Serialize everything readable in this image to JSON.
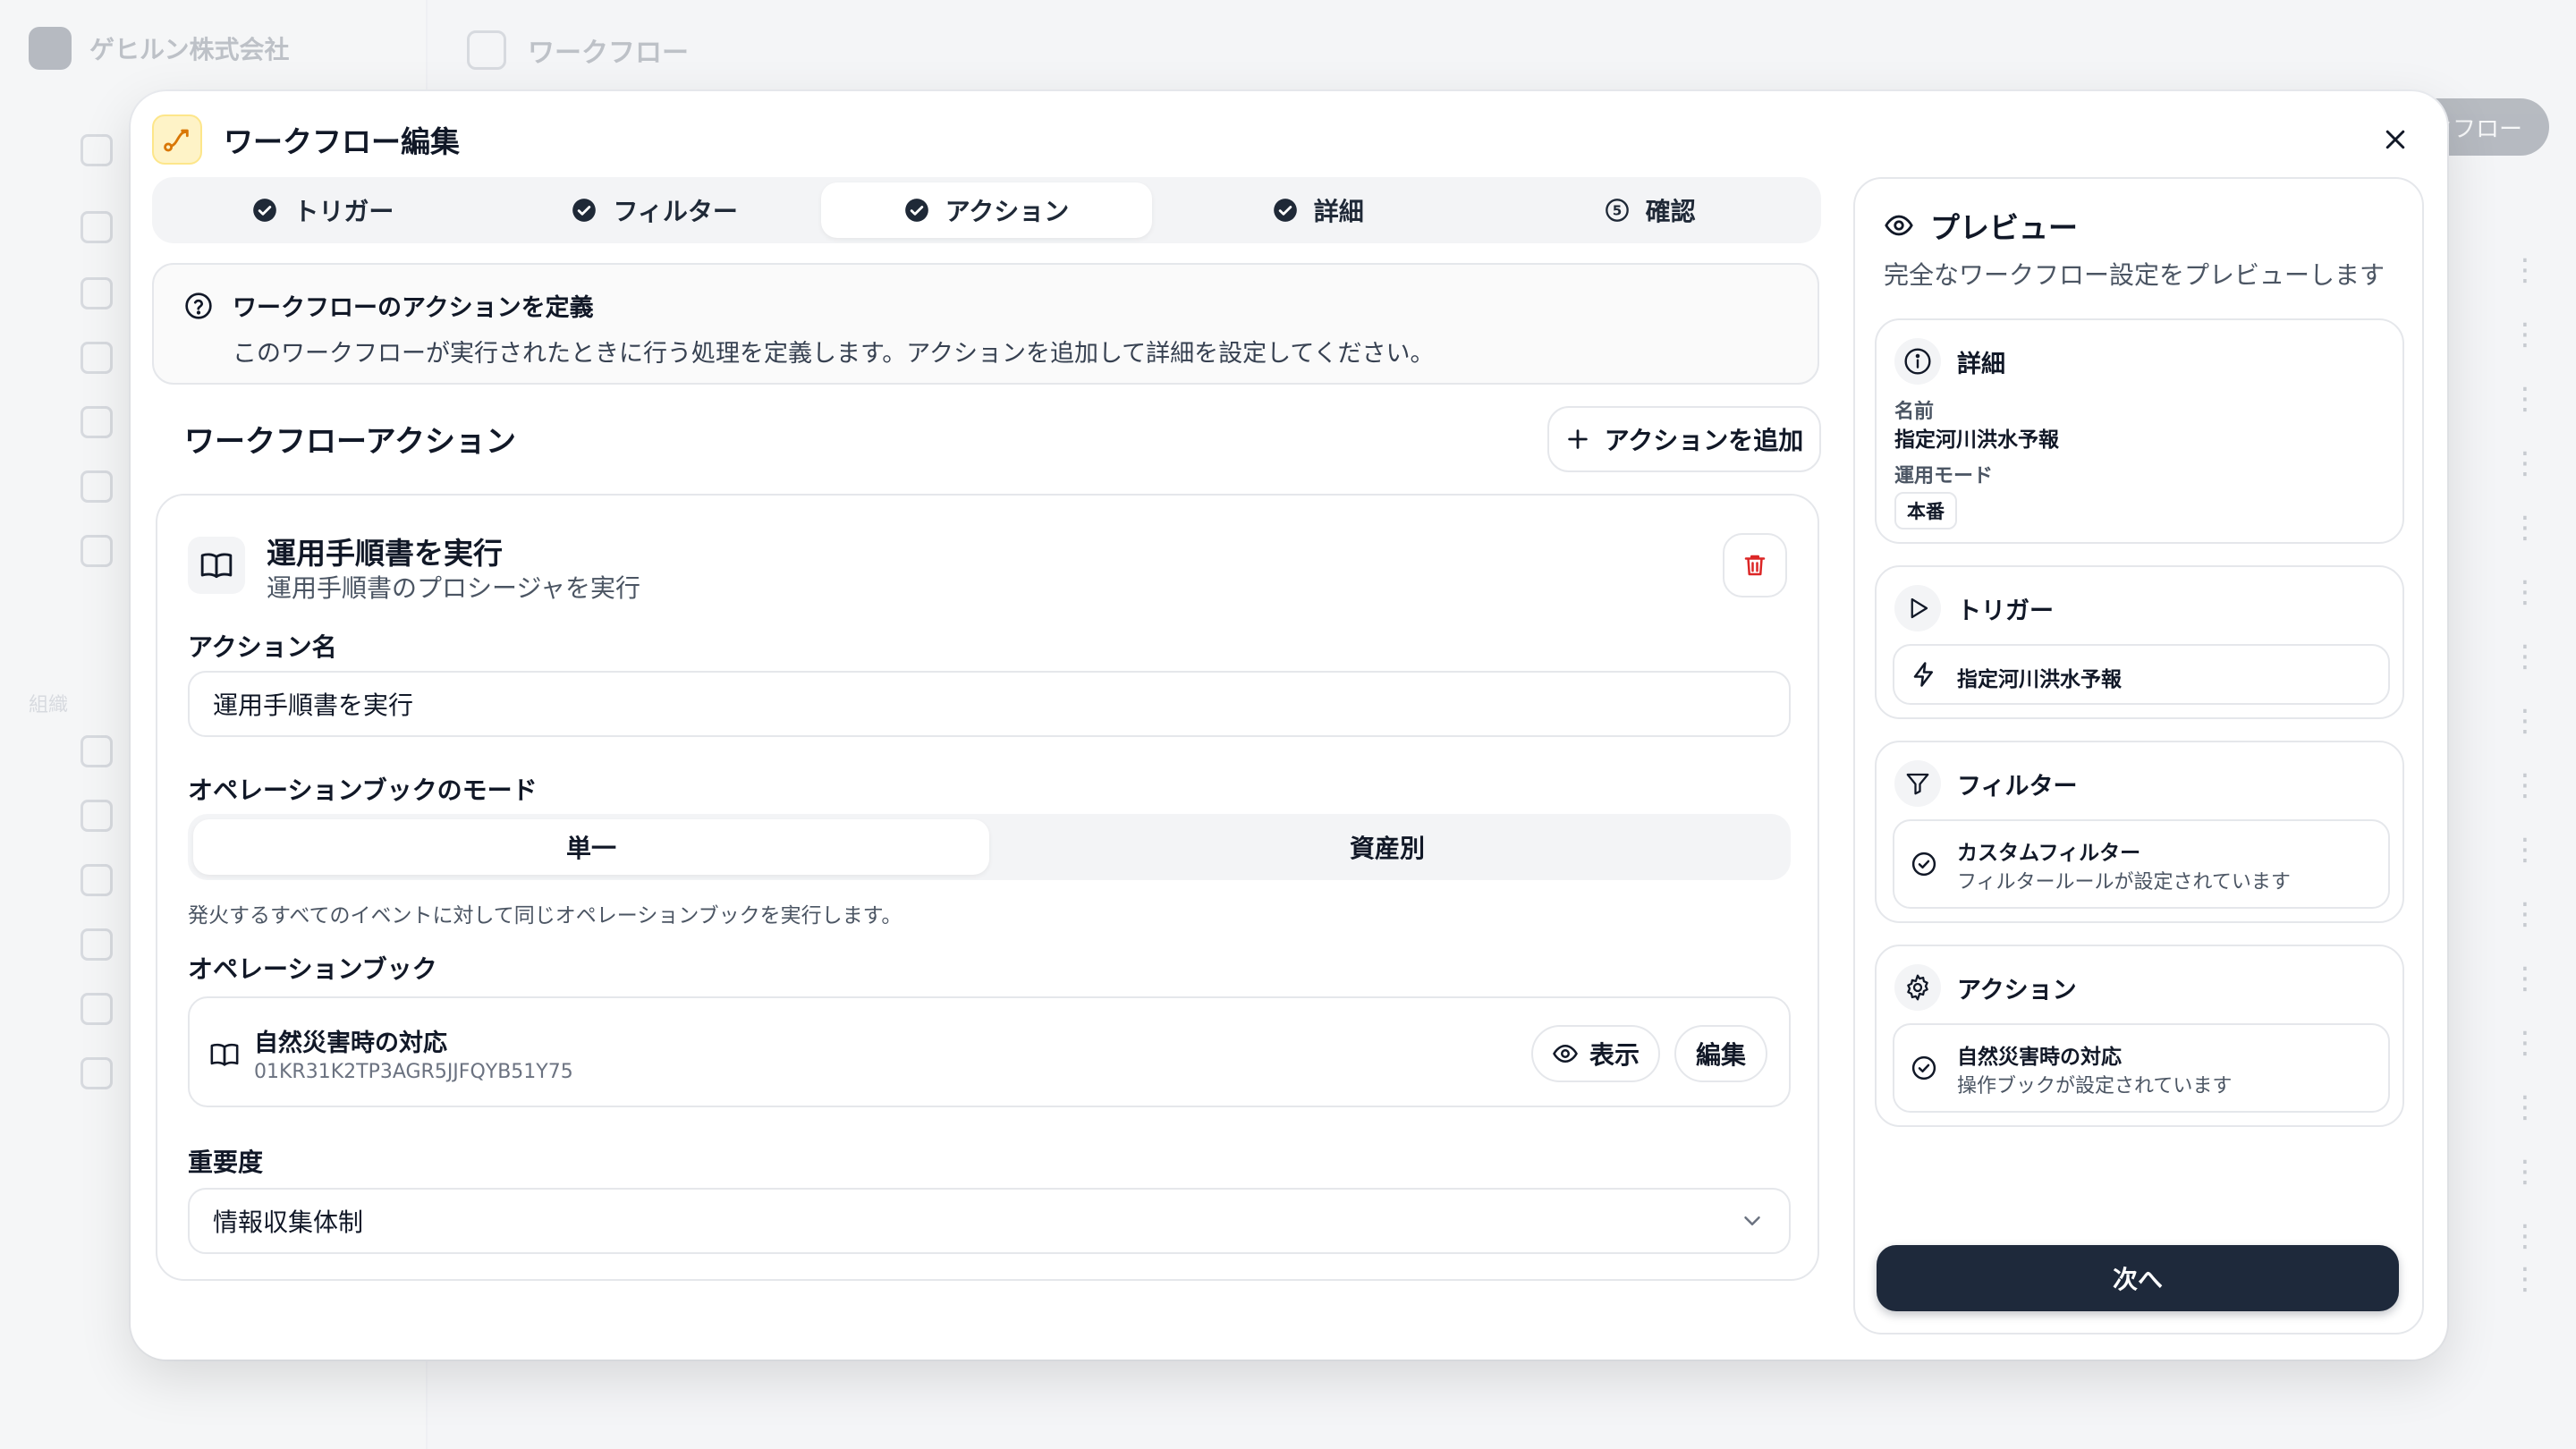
{
  "background": {
    "org_name": "ゲヒルン株式会社",
    "header_title": "ワークフロー",
    "section_label": "組織",
    "header_button": "ワークフロー"
  },
  "modal": {
    "title": "ワークフロー編集",
    "steps": [
      {
        "label": "トリガー",
        "state": "done"
      },
      {
        "label": "フィルター",
        "state": "done"
      },
      {
        "label": "アクション",
        "state": "active"
      },
      {
        "label": "詳細",
        "state": "done"
      },
      {
        "label": "確認",
        "state": "pending",
        "number": "5"
      }
    ],
    "info": {
      "title": "ワークフローのアクションを定義",
      "description": "このワークフローが実行されたときに行う処理を定義します。アクションを追加して詳細を設定してください。"
    },
    "actions_section": {
      "title": "ワークフローアクション",
      "add_button": "アクションを追加"
    },
    "action": {
      "title": "運用手順書を実行",
      "subtitle": "運用手順書のプロシージャを実行",
      "name_label": "アクション名",
      "name_value": "運用手順書を実行",
      "mode_label": "オペレーションブックのモード",
      "mode_options": [
        "単一",
        "資産別"
      ],
      "mode_selected": "単一",
      "mode_hint": "発火するすべてのイベントに対して同じオペレーションブックを実行します。",
      "operation_book_label": "オペレーションブック",
      "operation_book": {
        "name": "自然災害時の対応",
        "id": "01KR31K2TP3AGR5JJFQYB51Y75",
        "view_button": "表示",
        "edit_button": "編集"
      },
      "severity_label": "重要度",
      "severity_value": "情報収集体制"
    }
  },
  "preview": {
    "title": "プレビュー",
    "description": "完全なワークフロー設定をプレビューします",
    "details": {
      "title": "詳細",
      "name_label": "名前",
      "name_value": "指定河川洪水予報",
      "mode_label": "運用モード",
      "mode_value": "本番"
    },
    "trigger": {
      "title": "トリガー",
      "item": "指定河川洪水予報"
    },
    "filter": {
      "title": "フィルター",
      "item_title": "カスタムフィルター",
      "item_desc": "フィルタールールが設定されています"
    },
    "action": {
      "title": "アクション",
      "item_title": "自然災害時の対応",
      "item_desc": "操作ブックが設定されています"
    },
    "next_button": "次へ"
  },
  "colors": {
    "primary_dark": "#1e293b",
    "delete_red": "#dc2626",
    "workflow_icon_bg": "#fef3c7",
    "workflow_icon_accent": "#d97706"
  },
  "icons": {
    "close": "close-icon",
    "step_done": "check-circle-icon",
    "info": "help-circle-icon",
    "add": "plus-icon",
    "book": "book-open-icon",
    "delete": "trash-icon",
    "view": "eye-icon",
    "chevron": "chevron-down-icon"
  }
}
